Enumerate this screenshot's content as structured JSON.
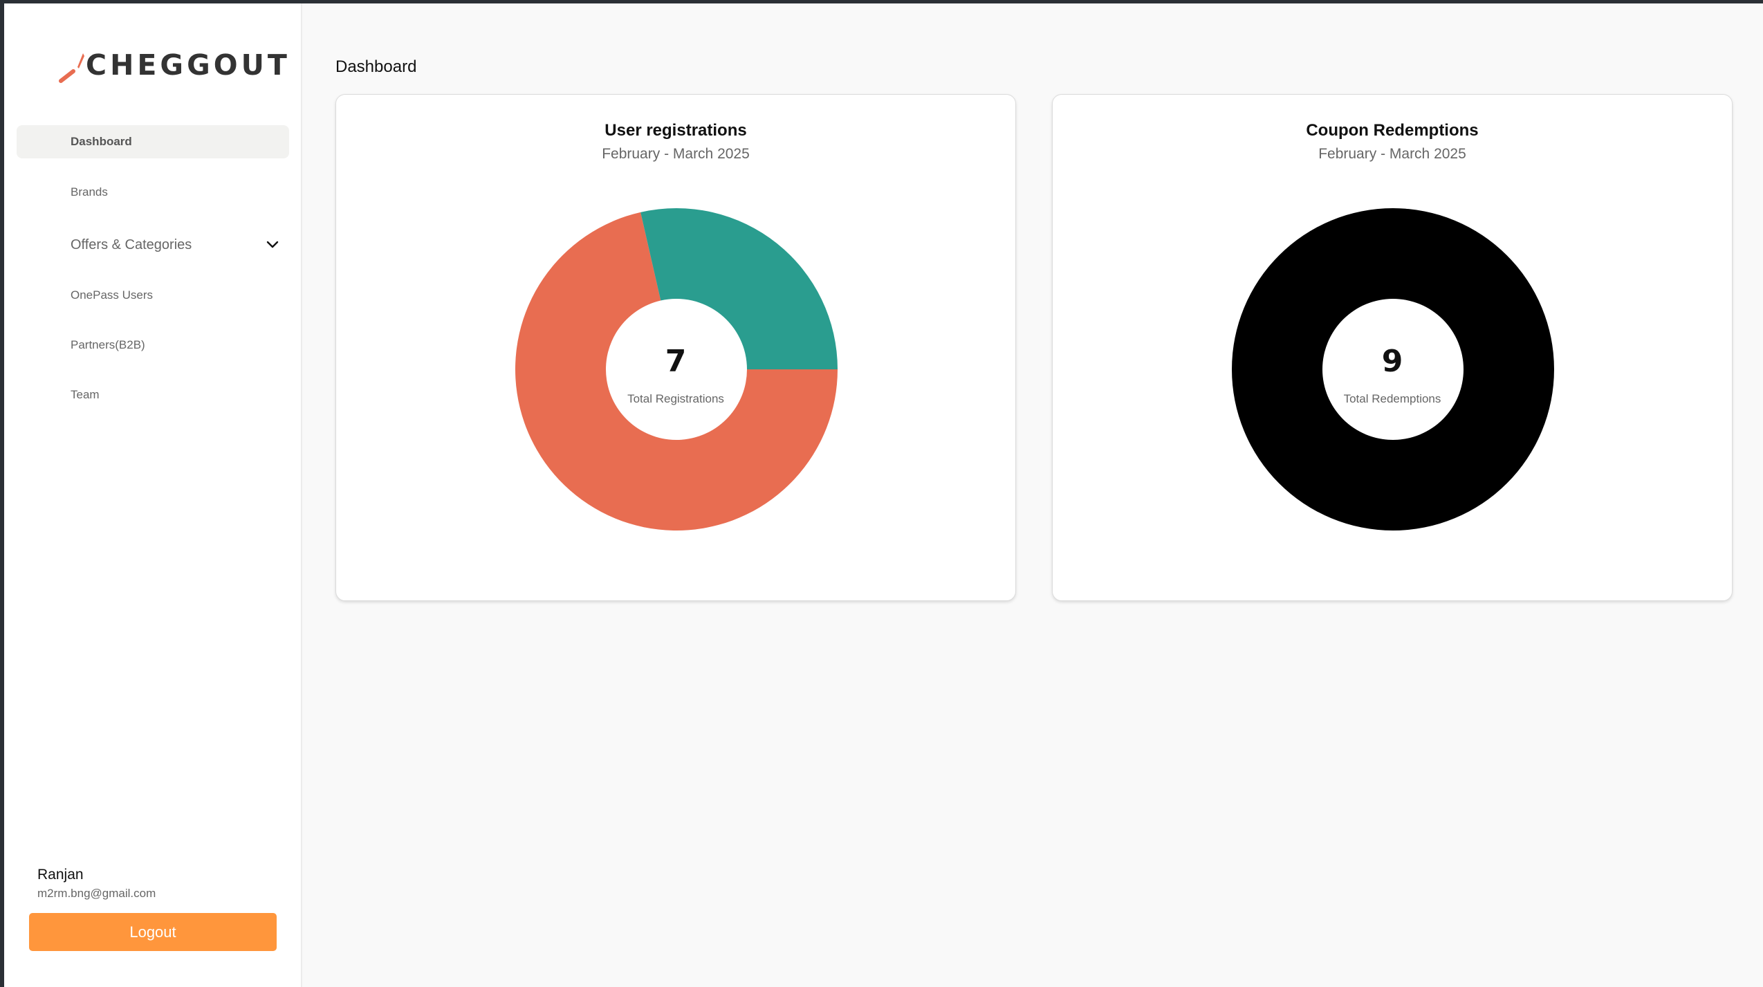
{
  "brand": {
    "logo_text": "CHEGGOUT",
    "accent": "#e86d51"
  },
  "sidebar": {
    "items": [
      {
        "label": "Dashboard",
        "active": true
      },
      {
        "label": "Brands"
      },
      {
        "label": "Offers & Categories",
        "icon": "chevron-down-icon"
      },
      {
        "label": "OnePass Users"
      },
      {
        "label": "Partners(B2B)"
      },
      {
        "label": "Team"
      }
    ]
  },
  "user": {
    "name": "Ranjan",
    "email": "m2rm.bng@gmail.com"
  },
  "logout_label": "Logout",
  "logout_color": "#ff963c",
  "page_title": "Dashboard",
  "cards": [
    {
      "title": "User registrations",
      "subtitle": "February - March 2025",
      "center_value": "7",
      "center_label": "Total Registrations"
    },
    {
      "title": "Coupon Redemptions",
      "subtitle": "February - March 2025",
      "center_value": "9",
      "center_label": "Total Redemptions"
    }
  ],
  "chart_data": [
    {
      "type": "pie",
      "title": "User registrations",
      "subtitle": "February - March 2025",
      "donut": true,
      "total": 7,
      "slices": [
        {
          "value": 5,
          "color": "#e86d51"
        },
        {
          "value": 2,
          "color": "#2a9d8f"
        }
      ]
    },
    {
      "type": "pie",
      "title": "Coupon Redemptions",
      "subtitle": "February - March 2025",
      "donut": true,
      "total": 9,
      "slices": [
        {
          "value": 9,
          "color": "#000000"
        }
      ]
    }
  ]
}
